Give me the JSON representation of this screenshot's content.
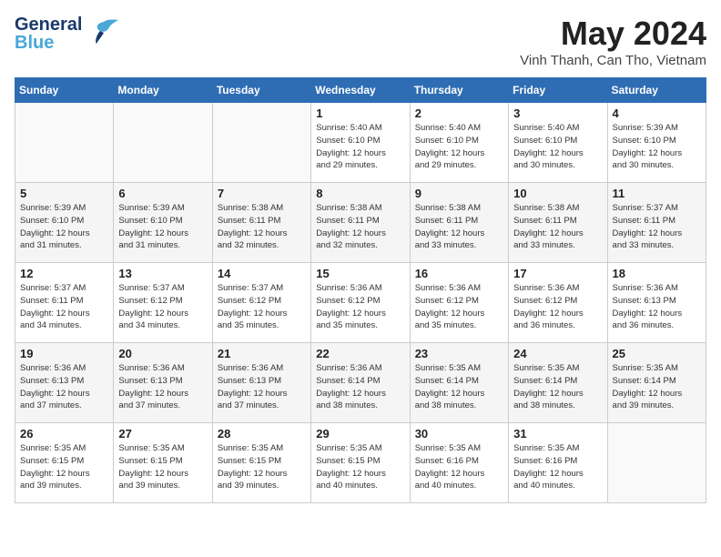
{
  "header": {
    "logo_line1": "General",
    "logo_line2": "Blue",
    "month_year": "May 2024",
    "location": "Vinh Thanh, Can Tho, Vietnam"
  },
  "calendar": {
    "days_of_week": [
      "Sunday",
      "Monday",
      "Tuesday",
      "Wednesday",
      "Thursday",
      "Friday",
      "Saturday"
    ],
    "weeks": [
      [
        {
          "day": "",
          "info": ""
        },
        {
          "day": "",
          "info": ""
        },
        {
          "day": "",
          "info": ""
        },
        {
          "day": "1",
          "info": "Sunrise: 5:40 AM\nSunset: 6:10 PM\nDaylight: 12 hours\nand 29 minutes."
        },
        {
          "day": "2",
          "info": "Sunrise: 5:40 AM\nSunset: 6:10 PM\nDaylight: 12 hours\nand 29 minutes."
        },
        {
          "day": "3",
          "info": "Sunrise: 5:40 AM\nSunset: 6:10 PM\nDaylight: 12 hours\nand 30 minutes."
        },
        {
          "day": "4",
          "info": "Sunrise: 5:39 AM\nSunset: 6:10 PM\nDaylight: 12 hours\nand 30 minutes."
        }
      ],
      [
        {
          "day": "5",
          "info": "Sunrise: 5:39 AM\nSunset: 6:10 PM\nDaylight: 12 hours\nand 31 minutes."
        },
        {
          "day": "6",
          "info": "Sunrise: 5:39 AM\nSunset: 6:10 PM\nDaylight: 12 hours\nand 31 minutes."
        },
        {
          "day": "7",
          "info": "Sunrise: 5:38 AM\nSunset: 6:11 PM\nDaylight: 12 hours\nand 32 minutes."
        },
        {
          "day": "8",
          "info": "Sunrise: 5:38 AM\nSunset: 6:11 PM\nDaylight: 12 hours\nand 32 minutes."
        },
        {
          "day": "9",
          "info": "Sunrise: 5:38 AM\nSunset: 6:11 PM\nDaylight: 12 hours\nand 33 minutes."
        },
        {
          "day": "10",
          "info": "Sunrise: 5:38 AM\nSunset: 6:11 PM\nDaylight: 12 hours\nand 33 minutes."
        },
        {
          "day": "11",
          "info": "Sunrise: 5:37 AM\nSunset: 6:11 PM\nDaylight: 12 hours\nand 33 minutes."
        }
      ],
      [
        {
          "day": "12",
          "info": "Sunrise: 5:37 AM\nSunset: 6:11 PM\nDaylight: 12 hours\nand 34 minutes."
        },
        {
          "day": "13",
          "info": "Sunrise: 5:37 AM\nSunset: 6:12 PM\nDaylight: 12 hours\nand 34 minutes."
        },
        {
          "day": "14",
          "info": "Sunrise: 5:37 AM\nSunset: 6:12 PM\nDaylight: 12 hours\nand 35 minutes."
        },
        {
          "day": "15",
          "info": "Sunrise: 5:36 AM\nSunset: 6:12 PM\nDaylight: 12 hours\nand 35 minutes."
        },
        {
          "day": "16",
          "info": "Sunrise: 5:36 AM\nSunset: 6:12 PM\nDaylight: 12 hours\nand 35 minutes."
        },
        {
          "day": "17",
          "info": "Sunrise: 5:36 AM\nSunset: 6:12 PM\nDaylight: 12 hours\nand 36 minutes."
        },
        {
          "day": "18",
          "info": "Sunrise: 5:36 AM\nSunset: 6:13 PM\nDaylight: 12 hours\nand 36 minutes."
        }
      ],
      [
        {
          "day": "19",
          "info": "Sunrise: 5:36 AM\nSunset: 6:13 PM\nDaylight: 12 hours\nand 37 minutes."
        },
        {
          "day": "20",
          "info": "Sunrise: 5:36 AM\nSunset: 6:13 PM\nDaylight: 12 hours\nand 37 minutes."
        },
        {
          "day": "21",
          "info": "Sunrise: 5:36 AM\nSunset: 6:13 PM\nDaylight: 12 hours\nand 37 minutes."
        },
        {
          "day": "22",
          "info": "Sunrise: 5:36 AM\nSunset: 6:14 PM\nDaylight: 12 hours\nand 38 minutes."
        },
        {
          "day": "23",
          "info": "Sunrise: 5:35 AM\nSunset: 6:14 PM\nDaylight: 12 hours\nand 38 minutes."
        },
        {
          "day": "24",
          "info": "Sunrise: 5:35 AM\nSunset: 6:14 PM\nDaylight: 12 hours\nand 38 minutes."
        },
        {
          "day": "25",
          "info": "Sunrise: 5:35 AM\nSunset: 6:14 PM\nDaylight: 12 hours\nand 39 minutes."
        }
      ],
      [
        {
          "day": "26",
          "info": "Sunrise: 5:35 AM\nSunset: 6:15 PM\nDaylight: 12 hours\nand 39 minutes."
        },
        {
          "day": "27",
          "info": "Sunrise: 5:35 AM\nSunset: 6:15 PM\nDaylight: 12 hours\nand 39 minutes."
        },
        {
          "day": "28",
          "info": "Sunrise: 5:35 AM\nSunset: 6:15 PM\nDaylight: 12 hours\nand 39 minutes."
        },
        {
          "day": "29",
          "info": "Sunrise: 5:35 AM\nSunset: 6:15 PM\nDaylight: 12 hours\nand 40 minutes."
        },
        {
          "day": "30",
          "info": "Sunrise: 5:35 AM\nSunset: 6:16 PM\nDaylight: 12 hours\nand 40 minutes."
        },
        {
          "day": "31",
          "info": "Sunrise: 5:35 AM\nSunset: 6:16 PM\nDaylight: 12 hours\nand 40 minutes."
        },
        {
          "day": "",
          "info": ""
        }
      ]
    ]
  }
}
